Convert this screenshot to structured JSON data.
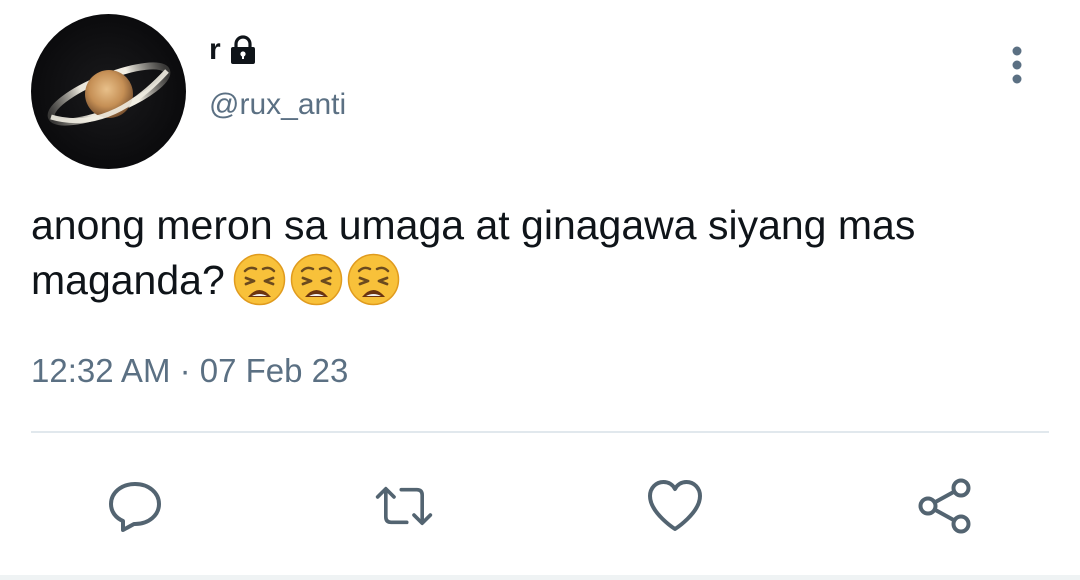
{
  "author": {
    "display_name": "r",
    "handle": "@rux_anti",
    "protected": true
  },
  "tweet": {
    "text": "anong meron sa umaga at ginagawa siyang mas maganda?",
    "emojis": [
      "weary-face",
      "weary-face",
      "weary-face"
    ],
    "timestamp": "12:32 AM · 07 Feb 23"
  },
  "actions": {
    "reply": "reply-icon",
    "retweet": "retweet-icon",
    "like": "heart-icon",
    "share": "share-icon"
  },
  "colors": {
    "text": "#0f1419",
    "secondary": "#5b7083",
    "divider": "#e1e8ed",
    "action_icon": "#536471"
  }
}
